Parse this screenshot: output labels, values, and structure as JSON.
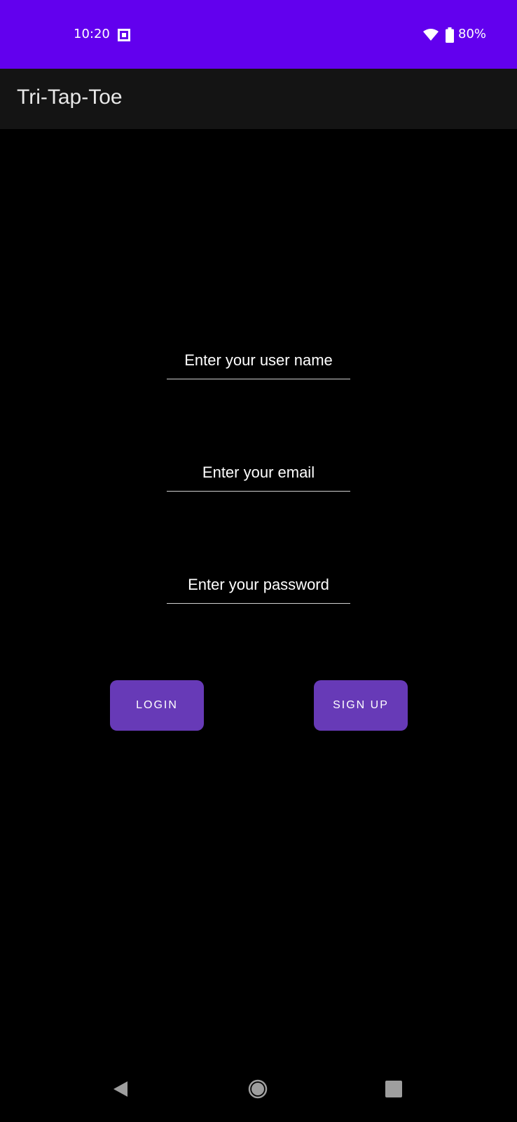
{
  "status_bar": {
    "time": "10:20",
    "battery": "80%",
    "icons": [
      "screen-record-icon",
      "wifi-icon",
      "battery-icon"
    ],
    "background": "#6200ee"
  },
  "app_bar": {
    "title": "Tri-Tap-Toe",
    "background": "#141414"
  },
  "form": {
    "username_placeholder": "Enter your user name",
    "email_placeholder": "Enter your email",
    "password_placeholder": "Enter your password"
  },
  "actions": {
    "login_label": "LOGIN",
    "signup_label": "SIGN UP",
    "button_color": "#673ab7"
  },
  "nav_bar": {
    "icons": [
      "back-icon",
      "home-icon",
      "recents-icon"
    ]
  }
}
